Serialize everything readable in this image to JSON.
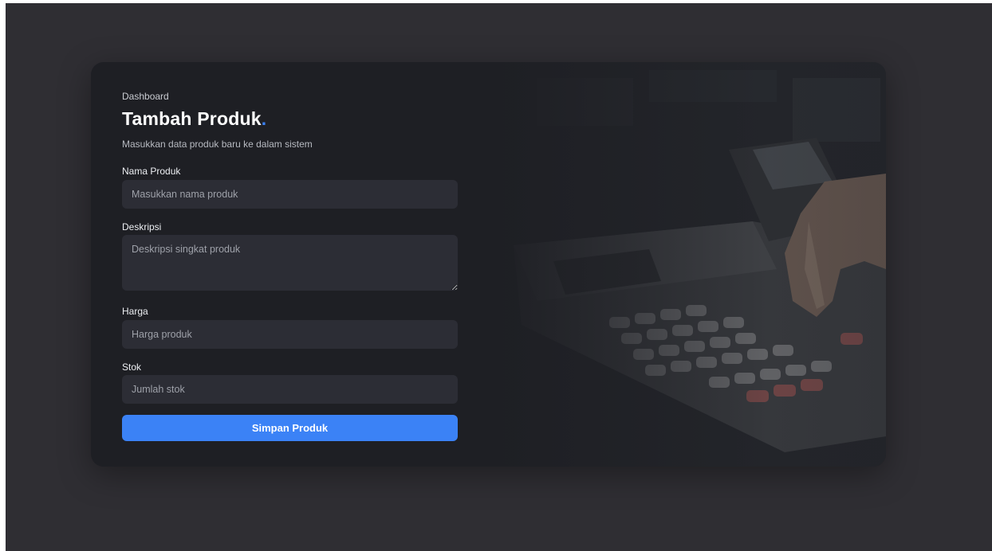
{
  "breadcrumb": "Dashboard",
  "title": "Tambah Produk",
  "title_dot": ".",
  "subtitle": "Masukkan data produk baru ke dalam sistem",
  "fields": {
    "nama": {
      "label": "Nama Produk",
      "placeholder": "Masukkan nama produk",
      "value": ""
    },
    "deskripsi": {
      "label": "Deskripsi",
      "placeholder": "Deskripsi singkat produk",
      "value": ""
    },
    "harga": {
      "label": "Harga",
      "placeholder": "Harga produk",
      "value": ""
    },
    "stok": {
      "label": "Stok",
      "placeholder": "Jumlah stok",
      "value": ""
    }
  },
  "submit_label": "Simpan Produk",
  "colors": {
    "accent": "#3b82f6",
    "card_bg": "#1e1f24",
    "page_bg": "#2f2e33",
    "input_bg": "#2c2d35"
  },
  "hero_image": "cash-register-photo"
}
